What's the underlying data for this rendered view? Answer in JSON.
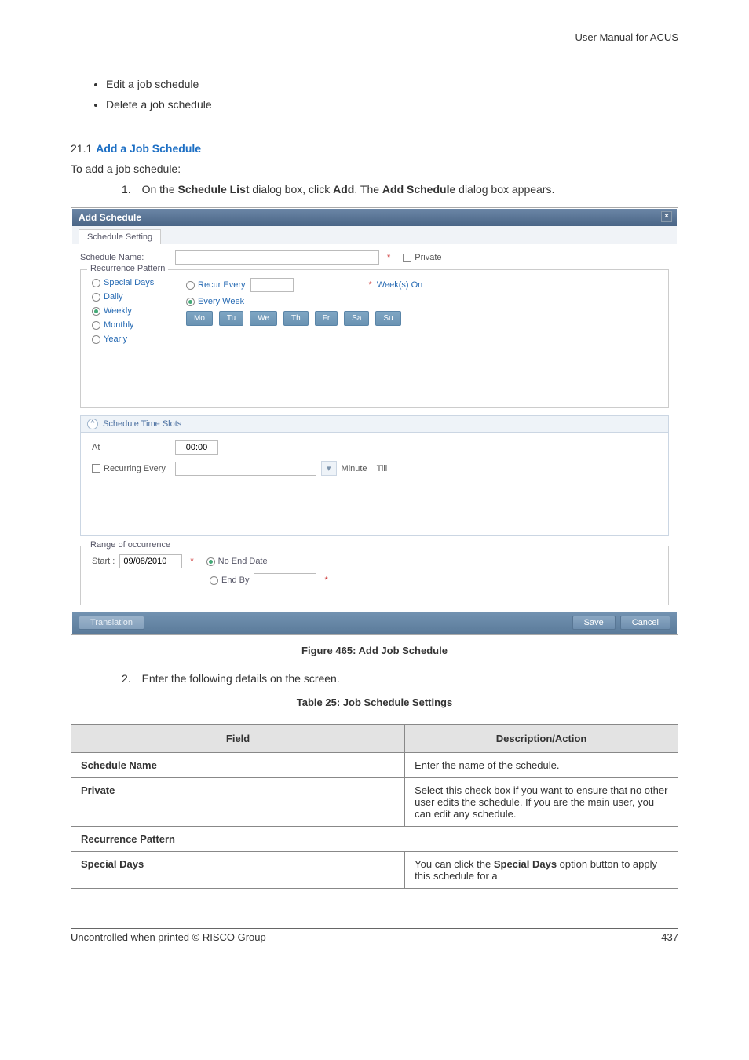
{
  "header": {
    "title": "User Manual for ACUS"
  },
  "bullets": [
    "Edit a job schedule",
    "Delete a job schedule"
  ],
  "section": {
    "number": "21.1",
    "title": "Add a Job Schedule",
    "intro": "To add a job schedule:",
    "step1_n": "1.",
    "step1_a": "On the ",
    "step1_b": "Schedule List",
    "step1_c": " dialog box, click ",
    "step1_d": "Add",
    "step1_e": ". The ",
    "step1_f": "Add Schedule",
    "step1_g": " dialog box appears.",
    "figure_caption": "Figure 465: Add Job Schedule",
    "step2_n": "2.",
    "step2_text": "Enter the following details on the screen.",
    "table_caption": "Table 25: Job Schedule Settings"
  },
  "dialog": {
    "title": "Add Schedule",
    "tab": "Schedule Setting",
    "schedule_name_label": "Schedule Name:",
    "schedule_name_value": "",
    "private_label": "Private",
    "pattern_legend": "Recurrence Pattern",
    "radios": {
      "special": "Special Days",
      "daily": "Daily",
      "weekly": "Weekly",
      "monthly": "Monthly",
      "yearly": "Yearly"
    },
    "recur_every_label": "Recur Every",
    "recur_every_value": "",
    "weeks_on": "Week(s) On",
    "every_week_label": "Every Week",
    "days": [
      "Mo",
      "Tu",
      "We",
      "Th",
      "Fr",
      "Sa",
      "Su"
    ],
    "ts_title": "Schedule Time Slots",
    "at_label": "At",
    "at_value": "00:00",
    "recurring_label": "Recurring Every",
    "recurring_value": "",
    "minute_label": "Minute",
    "till_label": "Till",
    "range_legend": "Range of occurrence",
    "start_label": "Start :",
    "start_value": "09/08/2010",
    "no_end_label": "No End Date",
    "end_by_label": "End By",
    "end_by_value": "",
    "btn_translation": "Translation",
    "btn_save": "Save",
    "btn_cancel": "Cancel"
  },
  "table": {
    "head_field": "Field",
    "head_desc": "Description/Action",
    "rows": [
      {
        "field": "Schedule Name",
        "desc": "Enter the name of the schedule."
      },
      {
        "field": "Private",
        "desc": "Select this check box if you want to ensure that no other user edits the schedule. If you are the main user, you can edit any schedule."
      }
    ],
    "span_row": "Recurrence Pattern",
    "row_special": {
      "field": "Special Days",
      "desc_a": "You can click the ",
      "desc_b": "Special Days",
      "desc_c": " option button to apply this schedule for a"
    }
  },
  "footer": {
    "left": "Uncontrolled when printed © RISCO Group",
    "right": "437"
  }
}
